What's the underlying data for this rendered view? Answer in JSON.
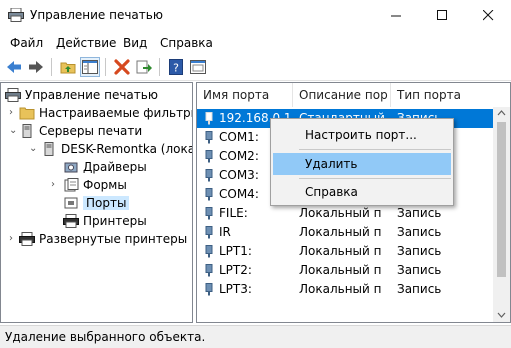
{
  "window": {
    "title": "Управление печатью"
  },
  "menu": [
    "Файл",
    "Действие",
    "Вид",
    "Справка"
  ],
  "tree": {
    "items": [
      {
        "label": "Управление печатью"
      },
      {
        "label": "Настраиваемые фильтры"
      },
      {
        "label": "Серверы печати"
      },
      {
        "label": "DESK-Remontka (локал"
      },
      {
        "label": "Драйверы"
      },
      {
        "label": "Формы"
      },
      {
        "label": "Порты"
      },
      {
        "label": "Принтеры"
      },
      {
        "label": "Развернутые принтеры"
      }
    ]
  },
  "list": {
    "columns": [
      "Имя порта",
      "Описание пор",
      "Тип порта"
    ],
    "rows": [
      {
        "name": "192.168.0.1",
        "desc": "Стандартный",
        "type": "Запись"
      },
      {
        "name": "COM1:",
        "desc": "",
        "type": ""
      },
      {
        "name": "COM2:",
        "desc": "",
        "type": ""
      },
      {
        "name": "COM3:",
        "desc": "",
        "type": ""
      },
      {
        "name": "COM4:",
        "desc": "",
        "type": ""
      },
      {
        "name": "FILE:",
        "desc": "Локальный п",
        "type": "Запись"
      },
      {
        "name": "IR",
        "desc": "Локальный п",
        "type": "Запись"
      },
      {
        "name": "LPT1:",
        "desc": "Локальный п",
        "type": "Запись"
      },
      {
        "name": "LPT2:",
        "desc": "Локальный п",
        "type": "Запись"
      },
      {
        "name": "LPT3:",
        "desc": "Локальный п",
        "type": "Запись"
      }
    ]
  },
  "context_menu": {
    "items": [
      "Настроить порт...",
      "Удалить",
      "Справка"
    ]
  },
  "status": {
    "text": "Удаление выбранного объекта."
  },
  "colors": {
    "selection": "#0078d7",
    "tree_selection": "#cce8ff",
    "menu_hover": "#91c9f7"
  }
}
